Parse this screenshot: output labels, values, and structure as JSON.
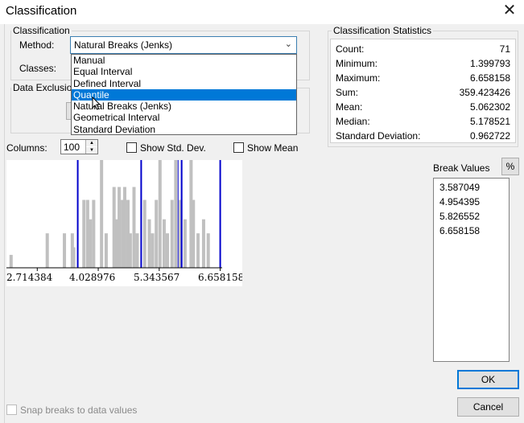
{
  "window": {
    "title": "Classification",
    "close_glyph": "✕"
  },
  "classification": {
    "group_label": "Classification",
    "method_label": "Method:",
    "method_value": "Natural Breaks (Jenks)",
    "classes_label": "Classes:",
    "method_options": [
      "Manual",
      "Equal Interval",
      "Defined Interval",
      "Quantile",
      "Natural Breaks (Jenks)",
      "Geometrical Interval",
      "Standard Deviation"
    ],
    "highlighted_option": "Quantile"
  },
  "data_exclusion": {
    "label": "Data Exclusion"
  },
  "statistics": {
    "group_label": "Classification Statistics",
    "rows": [
      {
        "label": "Count:",
        "value": "71"
      },
      {
        "label": "Minimum:",
        "value": "1.399793"
      },
      {
        "label": "Maximum:",
        "value": "6.658158"
      },
      {
        "label": "Sum:",
        "value": "359.423426"
      },
      {
        "label": "Mean:",
        "value": "5.062302"
      },
      {
        "label": "Median:",
        "value": "5.178521"
      },
      {
        "label": "Standard Deviation:",
        "value": "0.962722"
      }
    ]
  },
  "histogram_options": {
    "columns_label": "Columns:",
    "columns_value": "100",
    "show_std_dev_label": "Show Std. Dev.",
    "show_mean_label": "Show Mean"
  },
  "histogram": {
    "tick_labels": [
      "2.714384",
      "4.028976",
      "5.343567",
      "6.658158"
    ],
    "x_range": [
      2.05,
      6.7
    ],
    "bar_color": "#c0c0c0",
    "break_line_color": "#0000cc",
    "break_lines": [
      3.587049,
      4.954395,
      5.826552,
      6.658158
    ],
    "extra_line": 5.75,
    "bars": [
      {
        "x": 2.15,
        "h": 0.12
      },
      {
        "x": 2.93,
        "h": 0.32
      },
      {
        "x": 3.3,
        "h": 0.32
      },
      {
        "x": 3.47,
        "h": 0.32
      },
      {
        "x": 3.5,
        "h": 0.19
      },
      {
        "x": 3.72,
        "h": 0.63
      },
      {
        "x": 3.8,
        "h": 0.63
      },
      {
        "x": 3.86,
        "h": 0.45
      },
      {
        "x": 3.93,
        "h": 0.63
      },
      {
        "x": 4.1,
        "h": 1.0
      },
      {
        "x": 4.2,
        "h": 0.32
      },
      {
        "x": 4.37,
        "h": 0.75
      },
      {
        "x": 4.42,
        "h": 0.45
      },
      {
        "x": 4.48,
        "h": 0.75
      },
      {
        "x": 4.55,
        "h": 0.63
      },
      {
        "x": 4.6,
        "h": 0.75
      },
      {
        "x": 4.67,
        "h": 0.63
      },
      {
        "x": 4.72,
        "h": 0.32
      },
      {
        "x": 4.8,
        "h": 0.75
      },
      {
        "x": 4.87,
        "h": 0.32
      },
      {
        "x": 5.03,
        "h": 0.63
      },
      {
        "x": 5.13,
        "h": 0.45
      },
      {
        "x": 5.2,
        "h": 0.32
      },
      {
        "x": 5.28,
        "h": 0.63
      },
      {
        "x": 5.36,
        "h": 1.0
      },
      {
        "x": 5.45,
        "h": 0.45
      },
      {
        "x": 5.52,
        "h": 0.32
      },
      {
        "x": 5.62,
        "h": 0.63
      },
      {
        "x": 5.7,
        "h": 1.0
      },
      {
        "x": 5.8,
        "h": 0.63
      },
      {
        "x": 5.9,
        "h": 0.45
      },
      {
        "x": 6.03,
        "h": 1.0
      },
      {
        "x": 6.08,
        "h": 0.63
      },
      {
        "x": 6.18,
        "h": 0.32
      },
      {
        "x": 6.3,
        "h": 0.45
      },
      {
        "x": 6.4,
        "h": 0.32
      }
    ]
  },
  "break_values": {
    "label": "Break Values",
    "percent_label": "%",
    "values": [
      "3.587049",
      "4.954395",
      "5.826552",
      "6.658158"
    ]
  },
  "footer": {
    "snap_label": "Snap breaks to data values",
    "ok_label": "OK",
    "cancel_label": "Cancel"
  }
}
